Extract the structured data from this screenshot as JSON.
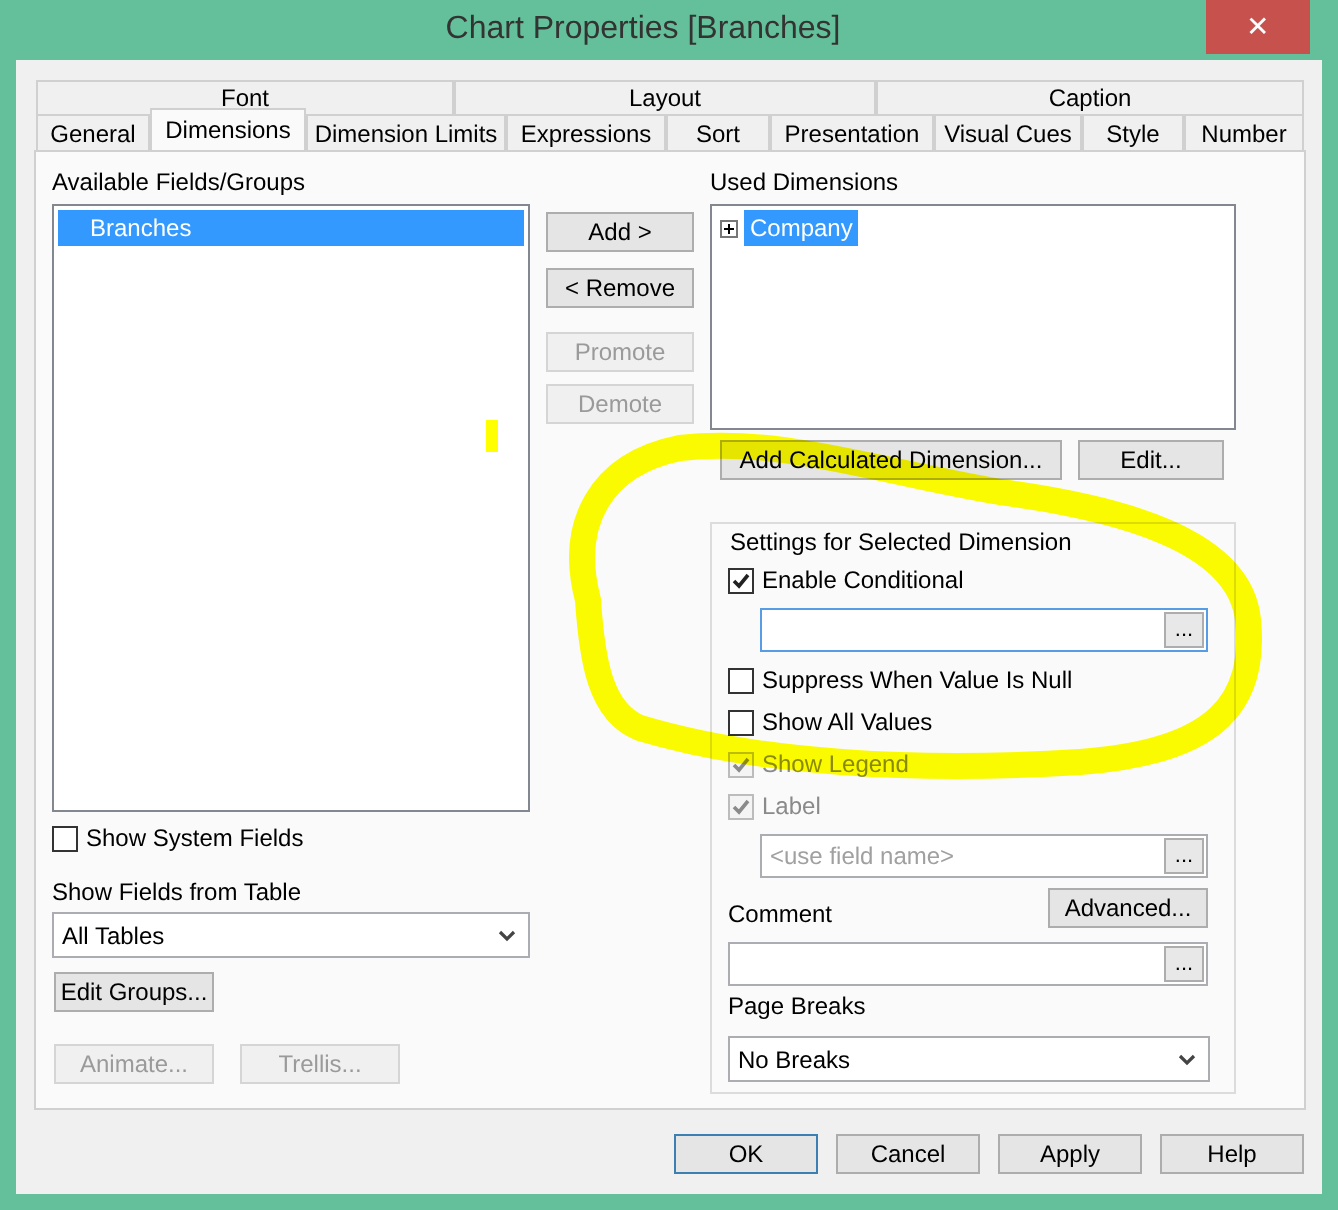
{
  "window": {
    "title": "Chart Properties [Branches]",
    "close": "✕"
  },
  "tabs": [
    [
      {
        "label": "Font",
        "selected": false
      },
      {
        "label": "Layout",
        "selected": false
      },
      {
        "label": "Caption",
        "selected": false
      }
    ],
    [
      {
        "label": "General",
        "selected": false
      },
      {
        "label": "Dimensions",
        "selected": true
      },
      {
        "label": "Dimension Limits",
        "selected": false
      },
      {
        "label": "Expressions",
        "selected": false
      },
      {
        "label": "Sort",
        "selected": false
      },
      {
        "label": "Presentation",
        "selected": false
      },
      {
        "label": "Visual Cues",
        "selected": false
      },
      {
        "label": "Style",
        "selected": false
      },
      {
        "label": "Number",
        "selected": false
      }
    ]
  ],
  "available_fields": {
    "label": "Available Fields/Groups",
    "items": [
      {
        "label": "Branches",
        "selected": true
      }
    ]
  },
  "move_buttons": [
    {
      "label": "Add >",
      "disabled": false
    },
    {
      "label": "< Remove",
      "disabled": false
    },
    {
      "label": "Promote",
      "disabled": true
    },
    {
      "label": "Demote",
      "disabled": true
    }
  ],
  "used_dimensions": {
    "label": "Used Dimensions",
    "items": [
      {
        "label": "Company",
        "selected": true,
        "expanded": false
      }
    ]
  },
  "dimension_buttons": [
    {
      "label": "Add Calculated Dimension..."
    },
    {
      "label": "Edit..."
    }
  ],
  "settings": {
    "title": "Settings for Selected Dimension",
    "items": [
      {
        "kind": "checkbox",
        "label": "Enable Conditional",
        "checked": true,
        "disabled": false
      },
      {
        "kind": "field",
        "focused": true,
        "button": "...",
        "indent": true
      },
      {
        "kind": "checkbox",
        "label": "Suppress When Value Is Null",
        "checked": false,
        "disabled": false
      },
      {
        "kind": "checkbox",
        "label": "Show All Values",
        "checked": false,
        "disabled": false
      },
      {
        "kind": "checkbox",
        "label": "Show Legend",
        "checked": true,
        "disabled": true
      },
      {
        "kind": "checkbox",
        "label": "Label",
        "checked": true,
        "disabled": true
      },
      {
        "kind": "field",
        "placeholder": "<use field name>",
        "focused": false,
        "button": "...",
        "indent": true
      },
      {
        "kind": "heading",
        "label": "Comment",
        "button": "Advanced..."
      },
      {
        "kind": "field",
        "focused": false,
        "button": "...",
        "indent": false
      },
      {
        "kind": "label",
        "label": "Page Breaks"
      },
      {
        "kind": "select",
        "value": "No Breaks"
      }
    ]
  },
  "show_system_fields": {
    "label": "Show System Fields",
    "checked": false
  },
  "show_fields_from_table": {
    "label": "Show Fields from Table",
    "value": "All Tables"
  },
  "edit_groups": {
    "label": "Edit Groups...",
    "disabled": false
  },
  "extra_buttons": [
    {
      "label": "Animate...",
      "disabled": true
    },
    {
      "label": "Trellis...",
      "disabled": true
    }
  ],
  "footer_buttons": [
    {
      "label": "OK",
      "default": true
    },
    {
      "label": "Cancel",
      "default": false
    },
    {
      "label": "Apply",
      "default": false
    },
    {
      "label": "Help",
      "default": false
    }
  ]
}
